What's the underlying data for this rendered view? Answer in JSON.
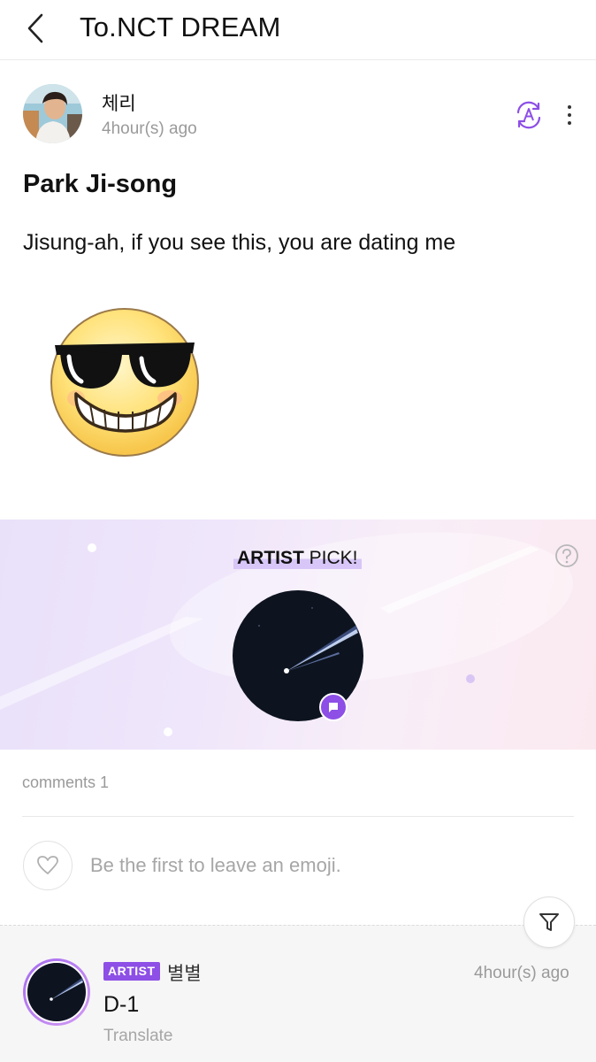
{
  "header": {
    "title": "To.NCT DREAM"
  },
  "post": {
    "author": "체리",
    "time": "4hour(s) ago",
    "title": "Park Ji-song",
    "body": "Jisung-ah, if you see this, you are dating me",
    "emoji_icon": "cool-sunglasses-emoji-icon"
  },
  "artist_pick": {
    "label_bold": "ARTIST",
    "label_rest": " PICK!"
  },
  "comments": {
    "count_label": "comments 1",
    "emoji_prompt": "Be the first to leave an emoji.",
    "items": [
      {
        "badge": "ARTIST",
        "author": "별별",
        "time": "4hour(s) ago",
        "text": "D-1",
        "translate_label": "Translate"
      }
    ]
  },
  "colors": {
    "accent": "#8d4fe6",
    "muted": "#9a9a9a"
  }
}
